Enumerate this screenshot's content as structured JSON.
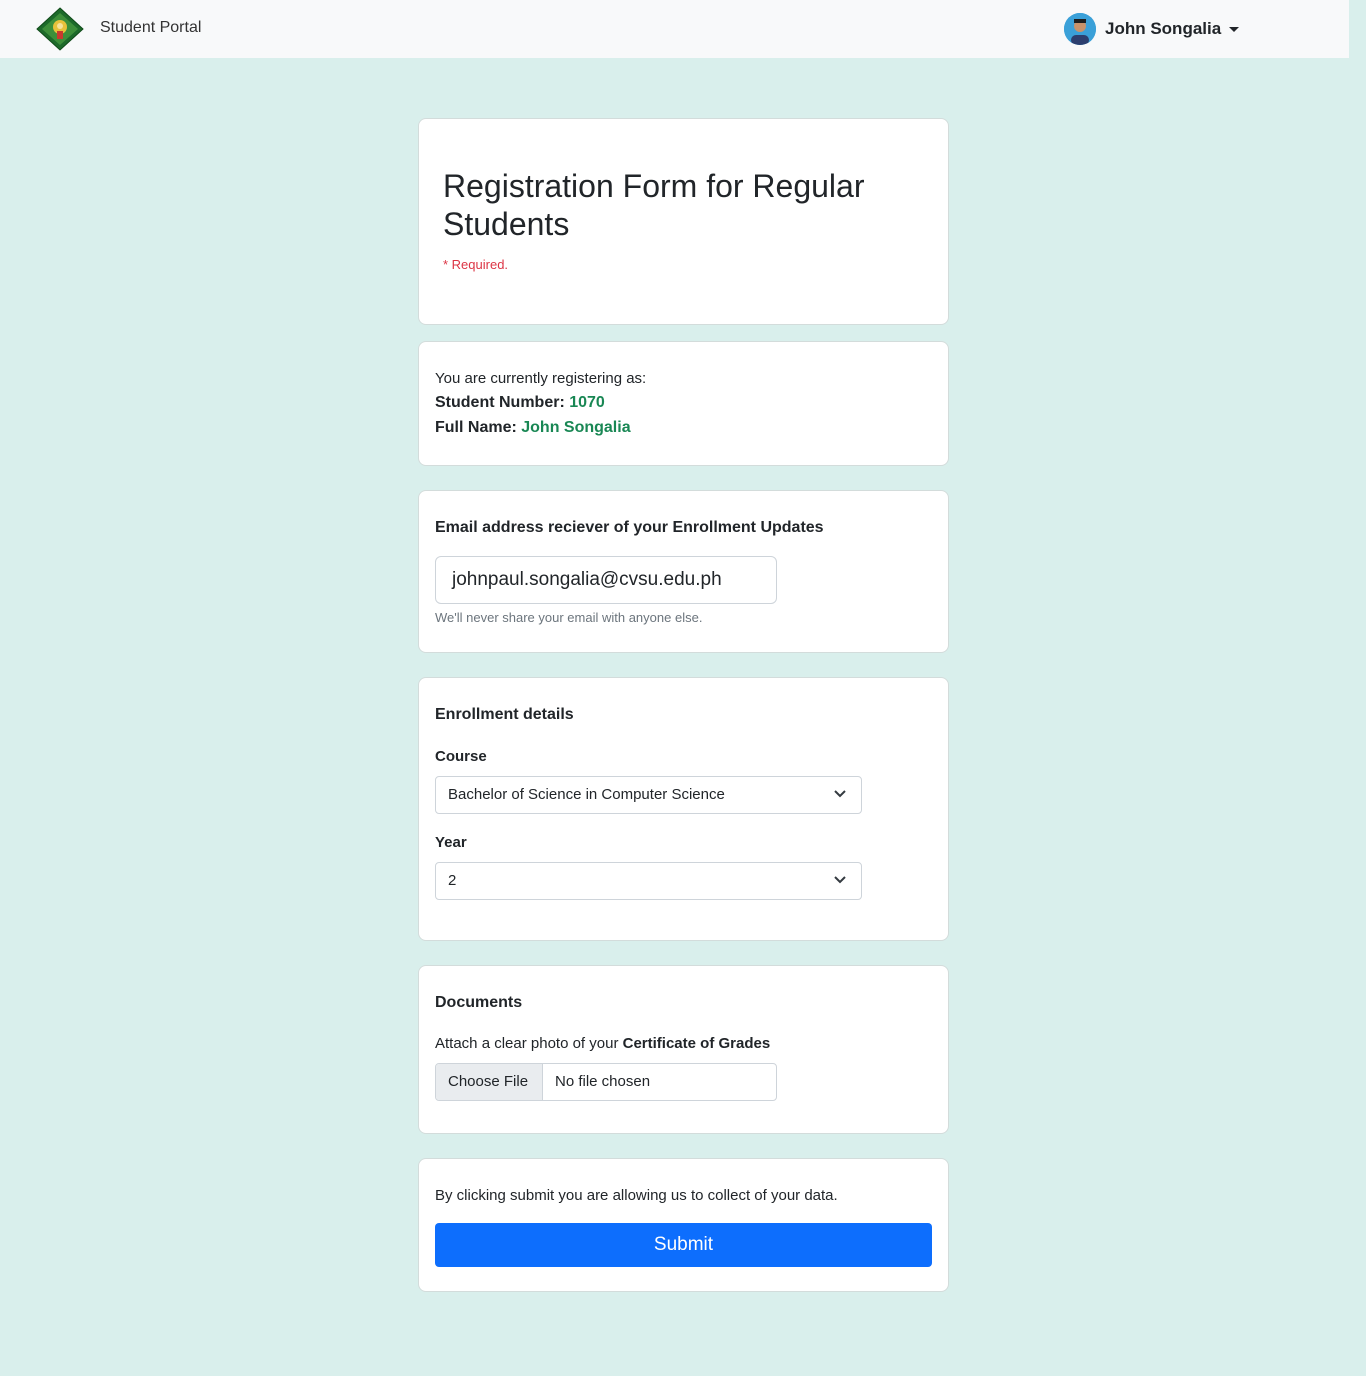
{
  "navbar": {
    "brand": "Student Portal",
    "user_name": "John Songalia"
  },
  "header_card": {
    "title": "Registration Form for Regular Students",
    "required_note": "* Required."
  },
  "identity_card": {
    "intro": "You are currently registering as:",
    "student_number_label": "Student Number:",
    "student_number": "1070",
    "full_name_label": "Full Name:",
    "full_name": "John Songalia"
  },
  "email_card": {
    "title": "Email address reciever of your Enrollment Updates",
    "email_value": "johnpaul.songalia@cvsu.edu.ph",
    "help": "We'll never share your email with anyone else."
  },
  "enrollment_card": {
    "title": "Enrollment details",
    "course_label": "Course",
    "course_value": "Bachelor of Science in Computer Science",
    "year_label": "Year",
    "year_value": "2"
  },
  "documents_card": {
    "title": "Documents",
    "instruction_prefix": "Attach a clear photo of your",
    "instruction_bold": "Certificate of Grades",
    "choose_file": "Choose File",
    "no_file": "No file chosen"
  },
  "submit_card": {
    "notice": "By clicking submit you are allowing us to collect of your data.",
    "submit_label": "Submit"
  },
  "colors": {
    "page_bg": "#d9efec",
    "accent_green": "#198754",
    "required_red": "#dc3545",
    "primary_blue": "#0d6efd"
  }
}
